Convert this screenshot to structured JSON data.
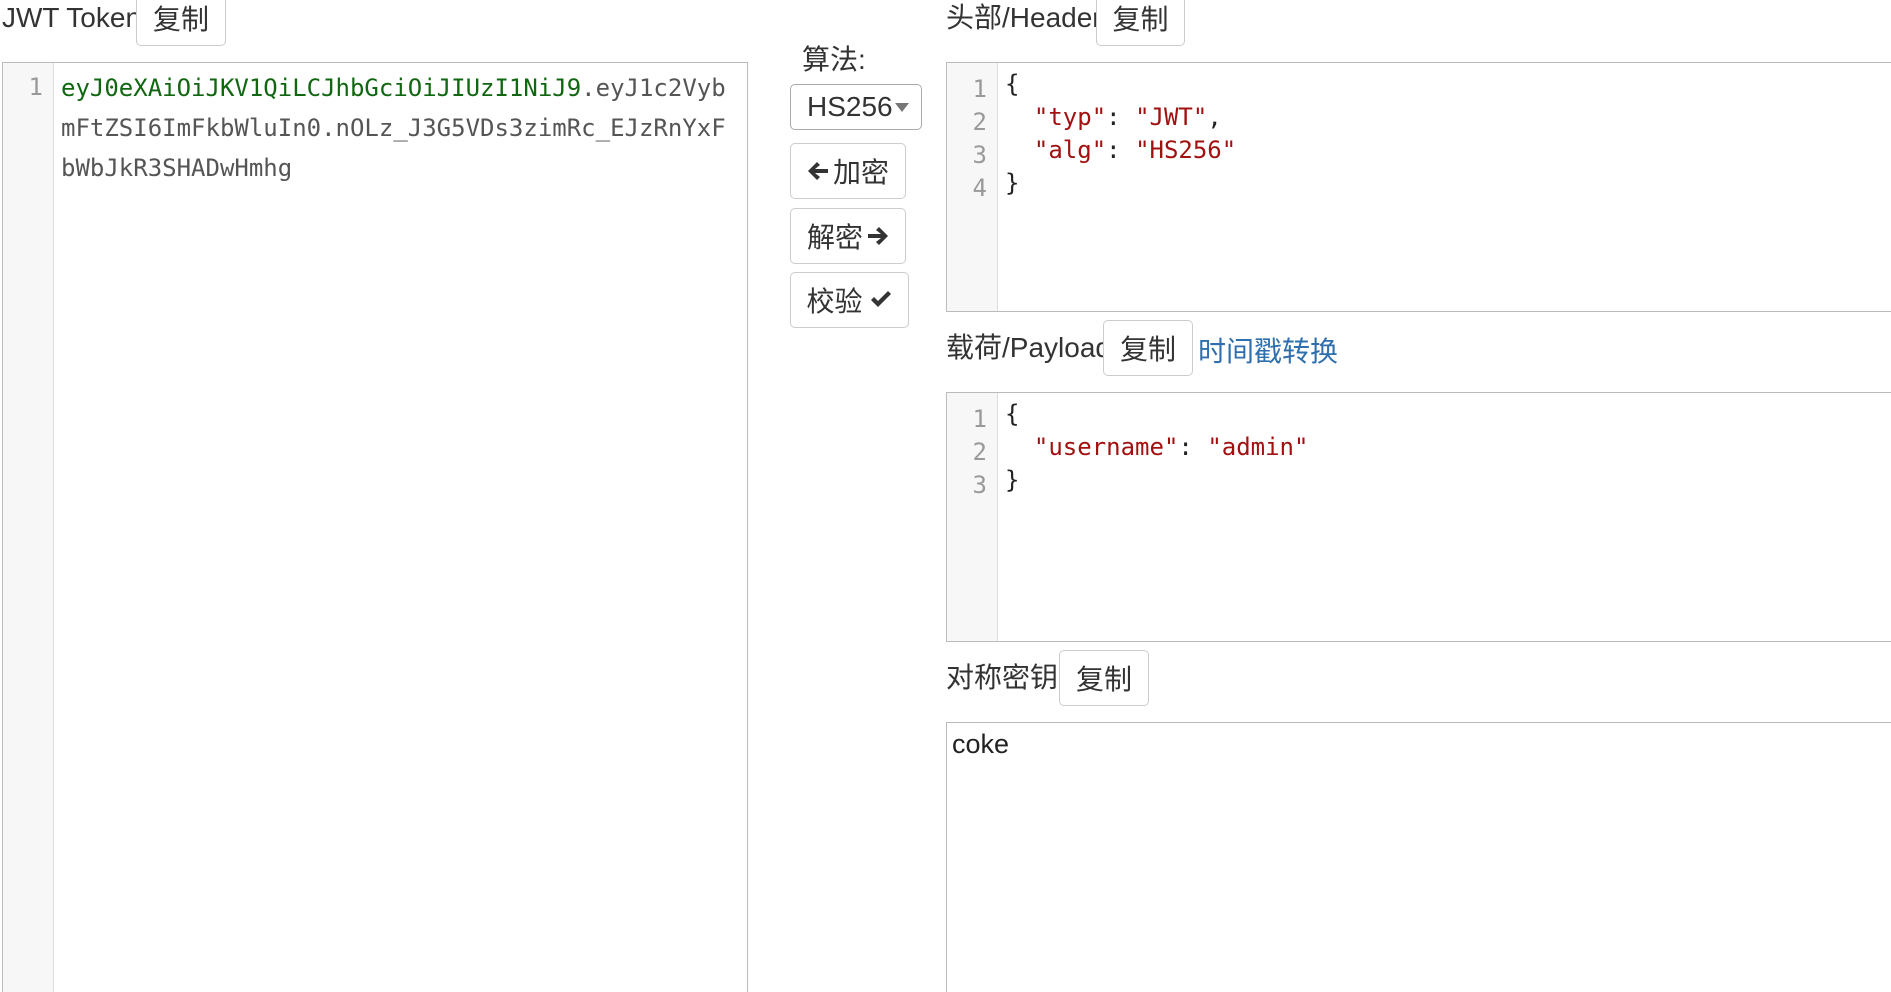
{
  "jwt": {
    "label": "JWT Token :",
    "copy_label": "复制",
    "line_number": "1",
    "token_header_part": "eyJ0eXAiOiJKV1QiLCJhbGciOiJIUzI1NiJ9",
    "token_rest_line1": ".eyJ1c2Vyb",
    "token_line2": "mFtZSI6ImFkbWluIn0.nOLz_J3G5VDs3zimRc_EJzRnYxF",
    "token_line3": "bWbJkR3SHADwHmhg"
  },
  "controls": {
    "algorithm_label": "算法:",
    "algorithm_selected": "HS256",
    "encrypt_label": "加密",
    "decrypt_label": "解密",
    "verify_label": "校验"
  },
  "header": {
    "label": "头部/Header :",
    "copy_label": "复制",
    "line_numbers": [
      "1",
      "2",
      "3",
      "4"
    ],
    "lines": [
      "{",
      "  \"typ\": \"JWT\",",
      "  \"alg\": \"HS256\"",
      "}"
    ],
    "open_brace": "{",
    "close_brace": "}",
    "typ_key": "\"typ\"",
    "typ_value": "\"JWT\"",
    "alg_key": "\"alg\"",
    "alg_value": "\"HS256\""
  },
  "payload": {
    "label": "载荷/Payload :",
    "copy_label": "复制",
    "timestamp_link": "时间戳转换",
    "line_numbers": [
      "1",
      "2",
      "3"
    ],
    "open_brace": "{",
    "close_brace": "}",
    "username_key": "\"username\"",
    "username_value": "\"admin\""
  },
  "secret": {
    "label": "对称密钥 :",
    "copy_label": "复制",
    "value": "coke"
  },
  "icons": {
    "encrypt": "arrow-left-icon",
    "decrypt": "arrow-right-icon",
    "verify": "check-icon",
    "select": "caret-down-icon"
  },
  "colors": {
    "link": "#2f6fad",
    "token_header": "#116611",
    "json_string": "#a11111"
  }
}
